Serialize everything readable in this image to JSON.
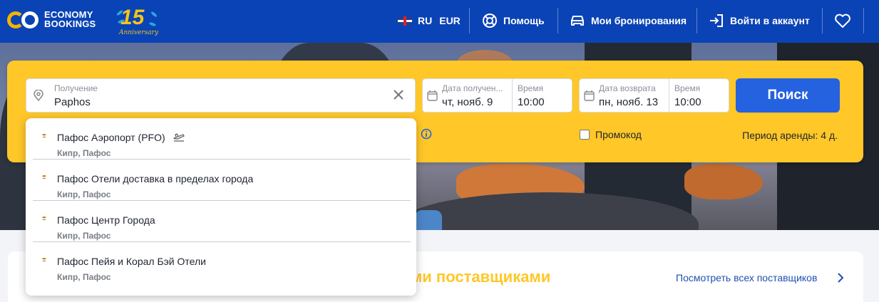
{
  "brand": {
    "line1": "ECONOMY",
    "line2": "BOOKINGS",
    "anniversary_number": "15",
    "anniversary_text": "Anniversary",
    "color": "#0a43b5",
    "accent": "#f5b301"
  },
  "header": {
    "language": "RU",
    "currency": "EUR",
    "help": "Помощь",
    "bookings": "Мои бронирования",
    "login": "Войти в аккаунт"
  },
  "search": {
    "pickup_label": "Получение",
    "pickup_value": "Paphos",
    "pickup_date_label": "Дата получен...",
    "pickup_date_value": "чт, нояб. 9",
    "pickup_time_label": "Время",
    "pickup_time_value": "10:00",
    "return_date_label": "Дата возврата",
    "return_date_value": "пн, нояб. 13",
    "return_time_label": "Время",
    "return_time_value": "10:00",
    "button": "Поиск",
    "promo_label": "Промокод",
    "rental_period": "Период аренды: 4 д.",
    "panel_color": "#ffc727",
    "button_color": "#2562e0"
  },
  "suggestions": [
    {
      "name": "Пафос Аэропорт (PFO)",
      "location": "Кипр, Пафос",
      "icon": "plane-icon"
    },
    {
      "name": "Пафос Отели доставка в пределах города",
      "location": "Кипр, Пафос"
    },
    {
      "name": "Пафос Центр Города",
      "location": "Кипр, Пафос"
    },
    {
      "name": "Пафос Пейя и Корал Бэй Отели",
      "location": "Кипр, Пафос"
    }
  ],
  "providers": {
    "title_fragment": "ми поставщиками",
    "link": "Посмотреть всех поставщиков"
  }
}
